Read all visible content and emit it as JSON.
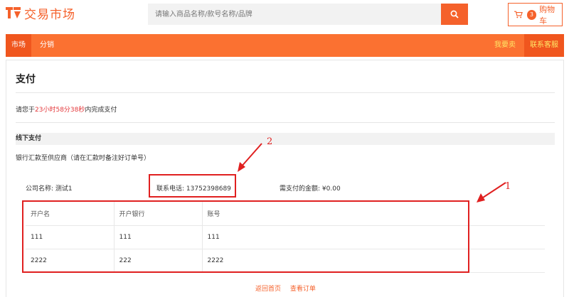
{
  "header": {
    "logo_text": "交易市场",
    "search_placeholder": "请输入商品名称/款号名称/品牌",
    "cart_count": "3",
    "cart_label": "购物车",
    "brand_color": "#f5612b"
  },
  "nav": {
    "items": [
      {
        "label": "市场",
        "active": true
      },
      {
        "label": "分销",
        "active": false
      }
    ],
    "sell_label": "我要卖",
    "service_label": "联系客服"
  },
  "payment": {
    "title": "支付",
    "countdown_prefix": "请您于",
    "countdown_time": "23小时58分38秒",
    "countdown_suffix": "内完成支付",
    "section_title": "线下支付",
    "bank_note": "银行汇款至供应商（请在汇款时备注好订单号）",
    "company_label": "公司名称:",
    "company_value": "测试1",
    "phone_label": "联系电话:",
    "phone_value": "13752398689",
    "amount_label": "需支付的金额:",
    "amount_value": "¥0.00"
  },
  "accounts_table": {
    "columns": [
      "开户名",
      "开户银行",
      "账号"
    ],
    "rows": [
      [
        "111",
        "111",
        "111"
      ],
      [
        "2222",
        "222",
        "2222"
      ]
    ]
  },
  "annotations": {
    "box1_number": "1",
    "box2_number": "2",
    "color": "#e02020"
  },
  "footer": {
    "home_link": "返回首页",
    "order_link": "查看订单"
  }
}
